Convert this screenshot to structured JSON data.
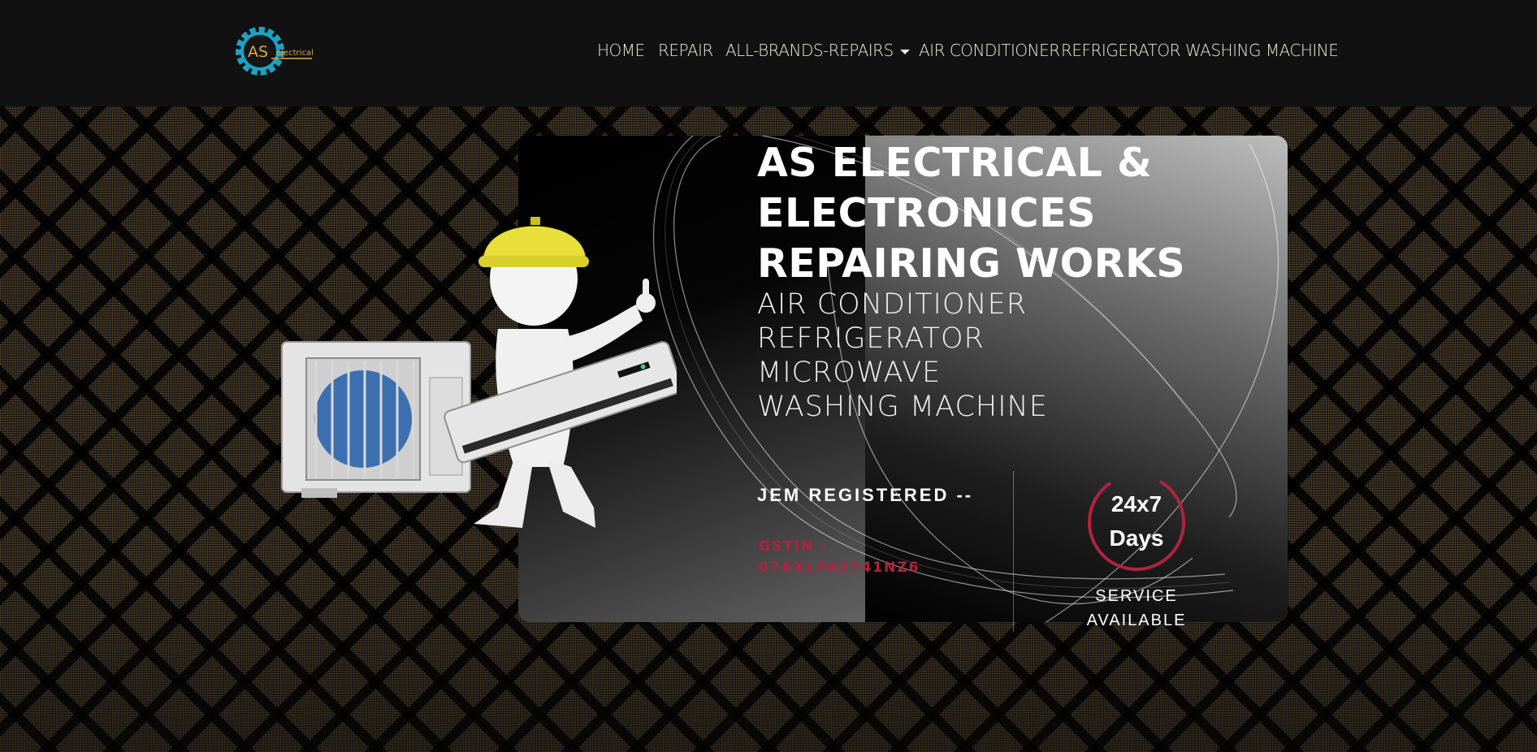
{
  "logo": {
    "mark_text": "AS",
    "word_text": "electrical",
    "gear_color": "#1aa3c2",
    "text_color": "#e0a84a"
  },
  "nav": {
    "items": [
      {
        "label": "HOME"
      },
      {
        "label": "REPAIR"
      },
      {
        "label": "ALL-BRANDS-REPAIRS",
        "has_dropdown": true
      },
      {
        "label": "AIR CONDITIONER"
      },
      {
        "label": "REFRIGERATOR"
      },
      {
        "label": "WASHING MACHINE"
      }
    ],
    "color": "#e8edcf"
  },
  "hero": {
    "headline": "AS ELECTRICAL & ELECTRONICES REPAIRING WORKS",
    "services": [
      "AIR CONDITIONER",
      "REFRIGERATOR",
      "MICROWAVE",
      "WASHING MACHINE"
    ],
    "registered": "JEM REGISTERED --",
    "gstin": "GSTIN - 07AXLPA5741NZ6",
    "availability": "24x7 Days",
    "service_available": "SERVICE AVAILABLE",
    "accent_color": "#b1233f"
  }
}
